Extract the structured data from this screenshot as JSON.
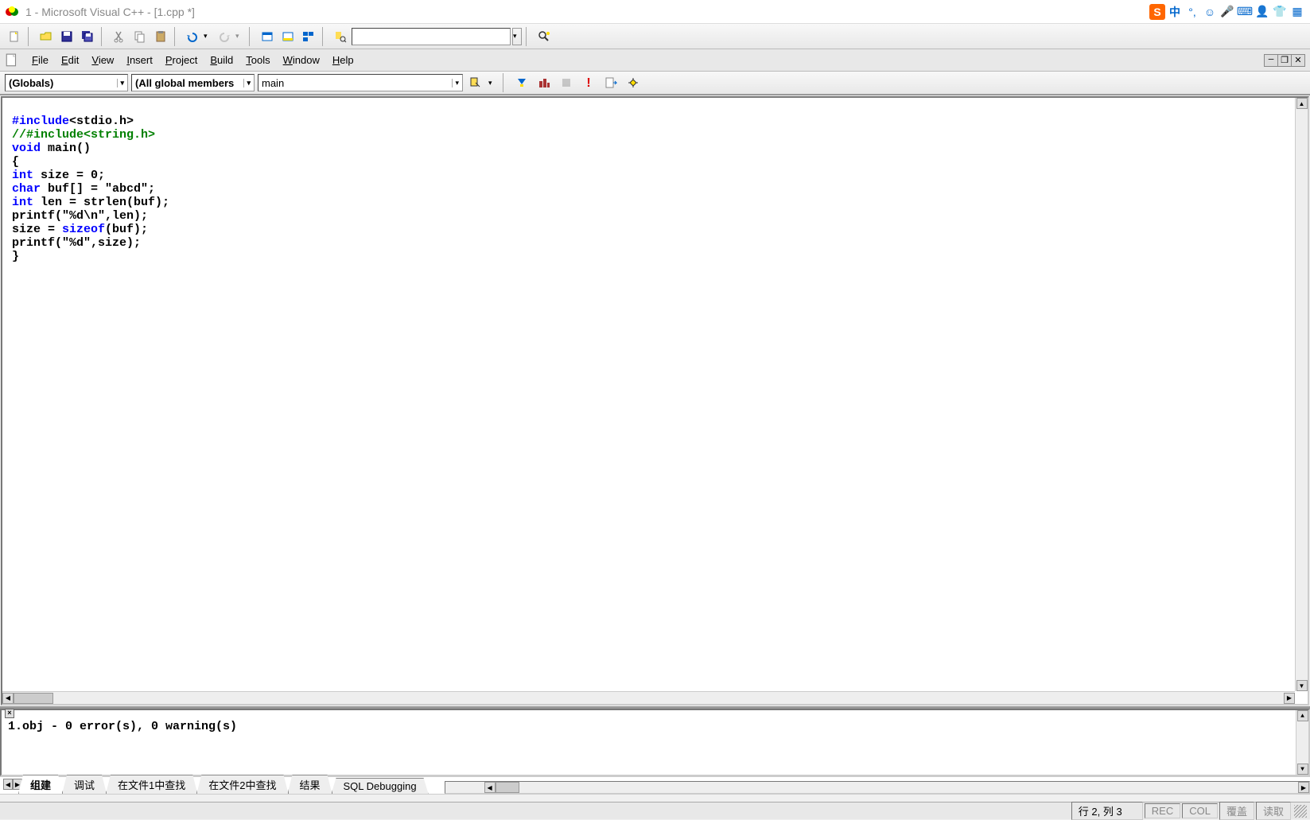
{
  "title": "1 - Microsoft Visual C++ - [1.cpp *]",
  "menu": {
    "file": "File",
    "edit": "Edit",
    "view": "View",
    "insert": "Insert",
    "project": "Project",
    "build": "Build",
    "tools": "Tools",
    "window": "Window",
    "help": "Help"
  },
  "dropdowns": {
    "scope": "(Globals)",
    "members": "(All global members",
    "func": "main"
  },
  "code": {
    "l1a": "#include",
    "l1b": "<stdio.h>",
    "l2": "//#include<string.h>",
    "l3a": "void",
    "l3b": " main()",
    "l4": "{",
    "l5a": "int",
    "l5b": " size = 0;",
    "l6a": "char",
    "l6b": " buf[] = \"abcd\";",
    "l7a": "int",
    "l7b": " len = strlen(buf);",
    "l8": "printf(\"%d\\n\",len);",
    "l9a": "size = ",
    "l9b": "sizeof",
    "l9c": "(buf);",
    "l10": "printf(\"%d\",size);",
    "l11": "}"
  },
  "output": {
    "text": "1.obj - 0 error(s), 0 warning(s)"
  },
  "tabs": {
    "build": "组建",
    "debug": "调试",
    "find1": "在文件1中查找",
    "find2": "在文件2中查找",
    "result": "结果",
    "sql": "SQL Debugging"
  },
  "status": {
    "pos": "行 2, 列 3",
    "rec": "REC",
    "col": "COL",
    "ov": "覆盖",
    "rd": "读取"
  },
  "ime": {
    "lang": "中"
  }
}
